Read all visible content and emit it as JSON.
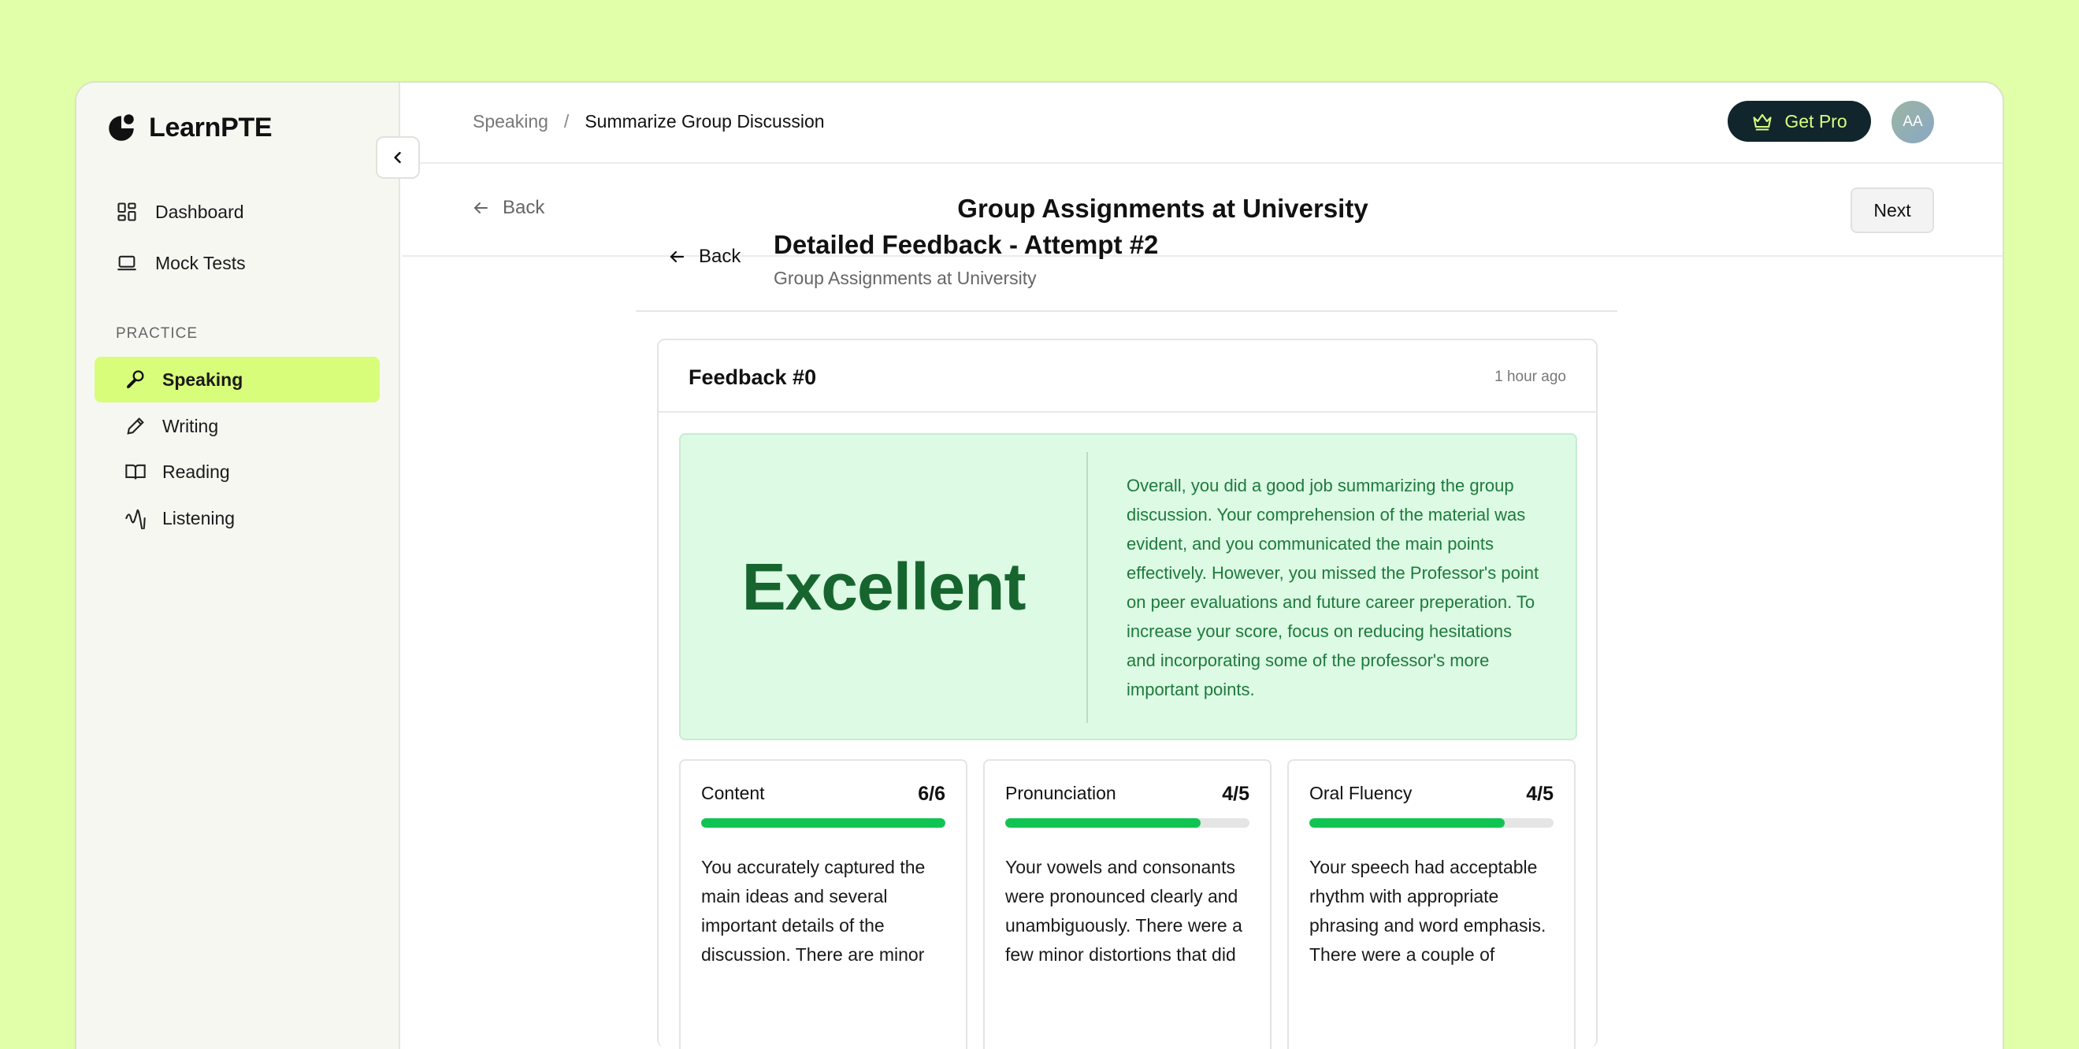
{
  "app": {
    "name": "LearnPTE"
  },
  "sidebar": {
    "main_items": [
      {
        "label": "Dashboard",
        "icon": "dashboard-icon"
      },
      {
        "label": "Mock Tests",
        "icon": "laptop-icon"
      }
    ],
    "section_label": "PRACTICE",
    "practice_items": [
      {
        "label": "Speaking",
        "icon": "microphone-icon",
        "active": true
      },
      {
        "label": "Writing",
        "icon": "pencil-icon",
        "active": false
      },
      {
        "label": "Reading",
        "icon": "book-icon",
        "active": false
      },
      {
        "label": "Listening",
        "icon": "waveform-icon",
        "active": false
      }
    ]
  },
  "topbar": {
    "breadcrumb": [
      "Speaking",
      "/",
      "Summarize Group Discussion"
    ],
    "get_pro_label": "Get Pro",
    "avatar_initials": "AA"
  },
  "titlebar": {
    "back_label": "Back",
    "title": "Group Assignments at University",
    "next_label": "Next"
  },
  "feedback_header": {
    "back_label": "Back",
    "title": "Detailed Feedback - Attempt #2",
    "subtitle": "Group Assignments at University"
  },
  "card": {
    "title": "Feedback #0",
    "time": "1 hour ago",
    "rating": "Excellent",
    "summary": "Overall, you did a good job summarizing the group discussion. Your comprehension of the material was evident, and you communicated the main points effectively. However, you missed the Professor's point on peer evaluations and future career preperation. To increase your score, focus on reducing hesitations and incorporating some of the professor's more important points.",
    "metrics": [
      {
        "label": "Content",
        "score": "6/6",
        "fraction": 1.0,
        "text": "You accurately captured the main ideas and several important details of the discussion. There are minor"
      },
      {
        "label": "Pronunciation",
        "score": "4/5",
        "fraction": 0.8,
        "text": "Your vowels and consonants were pronounced clearly and unambiguously. There were a few minor distortions that did"
      },
      {
        "label": "Oral Fluency",
        "score": "4/5",
        "fraction": 0.8,
        "text": "Your speech had acceptable rhythm with appropriate phrasing and word emphasis. There were a couple of"
      }
    ]
  },
  "colors": {
    "background": "#e1fea8",
    "accent": "#d8fd7a",
    "success": "#10c452",
    "rating_text": "#17652e",
    "pro_button": "#11252c"
  }
}
